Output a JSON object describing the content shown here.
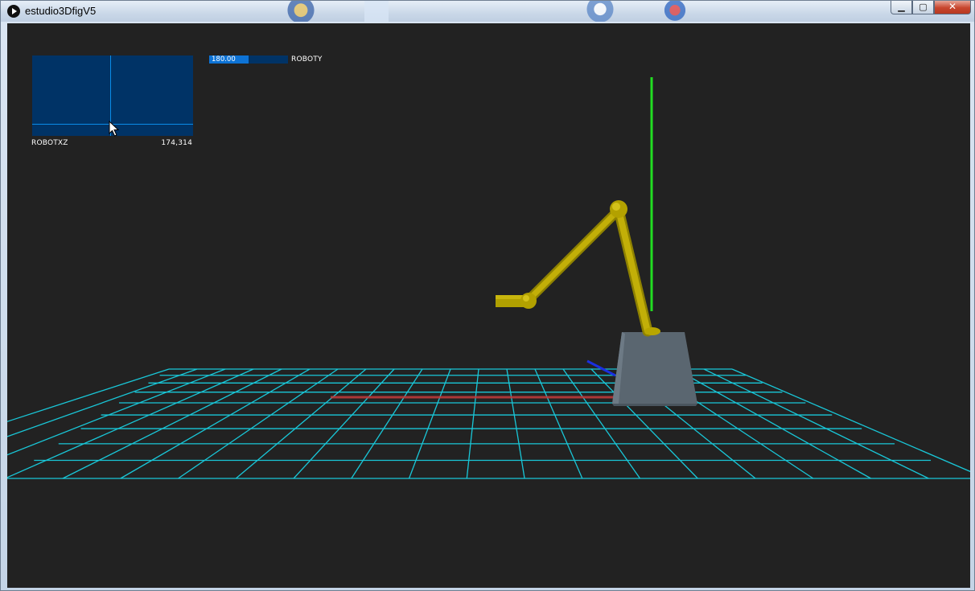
{
  "window": {
    "title": "estudio3DfigV5",
    "controls": [
      "minimize",
      "maximize",
      "close"
    ]
  },
  "controls": {
    "slider_xz": {
      "label": "ROBOTXZ",
      "value_text": "174,314"
    },
    "slider_y": {
      "label": "ROBOTY",
      "value_text": "180.00",
      "fill_fraction": 0.5
    }
  },
  "colors": {
    "canvas_bg": "#222222",
    "control_bg": "#003366",
    "control_active": "#0d73d6",
    "grid": "#19c7d8",
    "arm": "#b8a600",
    "base": "#5a6670",
    "axis_y": "#22dd22",
    "axis_x": "#c43a3a",
    "axis_z": "#1a2fe0"
  }
}
